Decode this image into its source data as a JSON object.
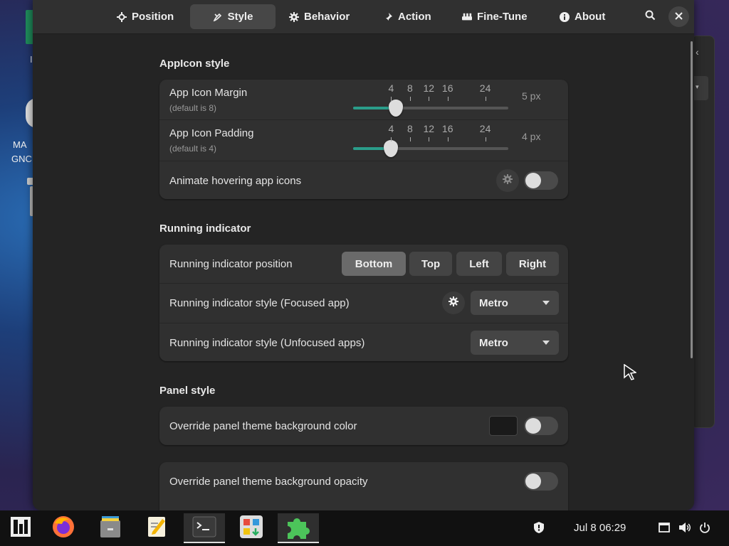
{
  "desktop": {
    "icon_label_line1": "MA",
    "icon_label_line2": "GNC",
    "icon_char": "I"
  },
  "tabs": [
    {
      "label": "Position",
      "icon": "crosshair-icon"
    },
    {
      "label": "Style",
      "icon": "brush-icon",
      "active": true
    },
    {
      "label": "Behavior",
      "icon": "gear-icon"
    },
    {
      "label": "Action",
      "icon": "pin-icon"
    },
    {
      "label": "Fine-Tune",
      "icon": "wrench-icon"
    },
    {
      "label": "About",
      "icon": "info-icon"
    }
  ],
  "appicon": {
    "title": "AppIcon style",
    "margin": {
      "title": "App Icon Margin",
      "sub": "(default is 8)",
      "value_label": "5 px",
      "value": 5
    },
    "padding": {
      "title": "App Icon Padding",
      "sub": "(default is 4)",
      "value_label": "4 px",
      "value": 4
    },
    "ticks": [
      "4",
      "8",
      "12",
      "16",
      "24"
    ],
    "animate": {
      "title": "Animate hovering app icons",
      "on": false
    }
  },
  "running": {
    "title": "Running indicator",
    "position": {
      "title": "Running indicator position",
      "options": [
        "Bottom",
        "Top",
        "Left",
        "Right"
      ],
      "selected": "Bottom"
    },
    "focused": {
      "title": "Running indicator style (Focused app)",
      "value": "Metro"
    },
    "unfocused": {
      "title": "Running indicator style (Unfocused apps)",
      "value": "Metro"
    }
  },
  "panel": {
    "title": "Panel style",
    "bgcolor": {
      "title": "Override panel theme background color",
      "color": "#1a1a1a",
      "on": false
    },
    "opacity": {
      "title": "Override panel theme background opacity",
      "on": false
    }
  },
  "colors": {
    "accent": "#2a9d8a"
  },
  "taskbar": {
    "apps": [
      "app-grid-icon",
      "firefox-icon",
      "files-icon",
      "text-editor-icon",
      "terminal-icon",
      "software-center-icon",
      "extensions-icon"
    ],
    "clock": "Jul 8  06:29"
  }
}
